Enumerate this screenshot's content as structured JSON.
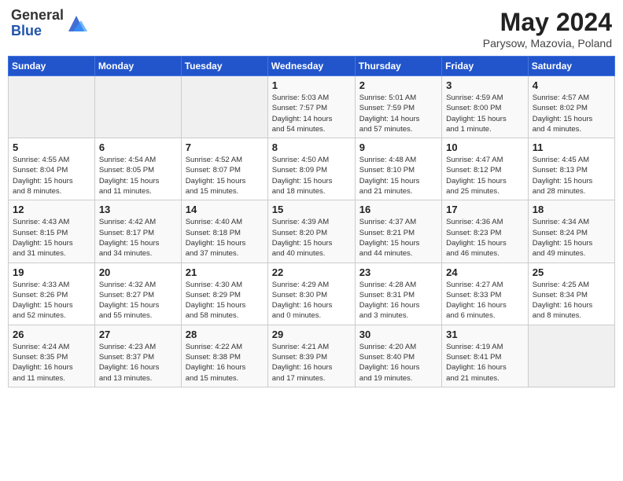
{
  "header": {
    "logo_general": "General",
    "logo_blue": "Blue",
    "title": "May 2024",
    "location": "Parysow, Mazovia, Poland"
  },
  "days_of_week": [
    "Sunday",
    "Monday",
    "Tuesday",
    "Wednesday",
    "Thursday",
    "Friday",
    "Saturday"
  ],
  "weeks": [
    [
      {
        "day": "",
        "info": ""
      },
      {
        "day": "",
        "info": ""
      },
      {
        "day": "",
        "info": ""
      },
      {
        "day": "1",
        "info": "Sunrise: 5:03 AM\nSunset: 7:57 PM\nDaylight: 14 hours\nand 54 minutes."
      },
      {
        "day": "2",
        "info": "Sunrise: 5:01 AM\nSunset: 7:59 PM\nDaylight: 14 hours\nand 57 minutes."
      },
      {
        "day": "3",
        "info": "Sunrise: 4:59 AM\nSunset: 8:00 PM\nDaylight: 15 hours\nand 1 minute."
      },
      {
        "day": "4",
        "info": "Sunrise: 4:57 AM\nSunset: 8:02 PM\nDaylight: 15 hours\nand 4 minutes."
      }
    ],
    [
      {
        "day": "5",
        "info": "Sunrise: 4:55 AM\nSunset: 8:04 PM\nDaylight: 15 hours\nand 8 minutes."
      },
      {
        "day": "6",
        "info": "Sunrise: 4:54 AM\nSunset: 8:05 PM\nDaylight: 15 hours\nand 11 minutes."
      },
      {
        "day": "7",
        "info": "Sunrise: 4:52 AM\nSunset: 8:07 PM\nDaylight: 15 hours\nand 15 minutes."
      },
      {
        "day": "8",
        "info": "Sunrise: 4:50 AM\nSunset: 8:09 PM\nDaylight: 15 hours\nand 18 minutes."
      },
      {
        "day": "9",
        "info": "Sunrise: 4:48 AM\nSunset: 8:10 PM\nDaylight: 15 hours\nand 21 minutes."
      },
      {
        "day": "10",
        "info": "Sunrise: 4:47 AM\nSunset: 8:12 PM\nDaylight: 15 hours\nand 25 minutes."
      },
      {
        "day": "11",
        "info": "Sunrise: 4:45 AM\nSunset: 8:13 PM\nDaylight: 15 hours\nand 28 minutes."
      }
    ],
    [
      {
        "day": "12",
        "info": "Sunrise: 4:43 AM\nSunset: 8:15 PM\nDaylight: 15 hours\nand 31 minutes."
      },
      {
        "day": "13",
        "info": "Sunrise: 4:42 AM\nSunset: 8:17 PM\nDaylight: 15 hours\nand 34 minutes."
      },
      {
        "day": "14",
        "info": "Sunrise: 4:40 AM\nSunset: 8:18 PM\nDaylight: 15 hours\nand 37 minutes."
      },
      {
        "day": "15",
        "info": "Sunrise: 4:39 AM\nSunset: 8:20 PM\nDaylight: 15 hours\nand 40 minutes."
      },
      {
        "day": "16",
        "info": "Sunrise: 4:37 AM\nSunset: 8:21 PM\nDaylight: 15 hours\nand 44 minutes."
      },
      {
        "day": "17",
        "info": "Sunrise: 4:36 AM\nSunset: 8:23 PM\nDaylight: 15 hours\nand 46 minutes."
      },
      {
        "day": "18",
        "info": "Sunrise: 4:34 AM\nSunset: 8:24 PM\nDaylight: 15 hours\nand 49 minutes."
      }
    ],
    [
      {
        "day": "19",
        "info": "Sunrise: 4:33 AM\nSunset: 8:26 PM\nDaylight: 15 hours\nand 52 minutes."
      },
      {
        "day": "20",
        "info": "Sunrise: 4:32 AM\nSunset: 8:27 PM\nDaylight: 15 hours\nand 55 minutes."
      },
      {
        "day": "21",
        "info": "Sunrise: 4:30 AM\nSunset: 8:29 PM\nDaylight: 15 hours\nand 58 minutes."
      },
      {
        "day": "22",
        "info": "Sunrise: 4:29 AM\nSunset: 8:30 PM\nDaylight: 16 hours\nand 0 minutes."
      },
      {
        "day": "23",
        "info": "Sunrise: 4:28 AM\nSunset: 8:31 PM\nDaylight: 16 hours\nand 3 minutes."
      },
      {
        "day": "24",
        "info": "Sunrise: 4:27 AM\nSunset: 8:33 PM\nDaylight: 16 hours\nand 6 minutes."
      },
      {
        "day": "25",
        "info": "Sunrise: 4:25 AM\nSunset: 8:34 PM\nDaylight: 16 hours\nand 8 minutes."
      }
    ],
    [
      {
        "day": "26",
        "info": "Sunrise: 4:24 AM\nSunset: 8:35 PM\nDaylight: 16 hours\nand 11 minutes."
      },
      {
        "day": "27",
        "info": "Sunrise: 4:23 AM\nSunset: 8:37 PM\nDaylight: 16 hours\nand 13 minutes."
      },
      {
        "day": "28",
        "info": "Sunrise: 4:22 AM\nSunset: 8:38 PM\nDaylight: 16 hours\nand 15 minutes."
      },
      {
        "day": "29",
        "info": "Sunrise: 4:21 AM\nSunset: 8:39 PM\nDaylight: 16 hours\nand 17 minutes."
      },
      {
        "day": "30",
        "info": "Sunrise: 4:20 AM\nSunset: 8:40 PM\nDaylight: 16 hours\nand 19 minutes."
      },
      {
        "day": "31",
        "info": "Sunrise: 4:19 AM\nSunset: 8:41 PM\nDaylight: 16 hours\nand 21 minutes."
      },
      {
        "day": "",
        "info": ""
      }
    ]
  ]
}
